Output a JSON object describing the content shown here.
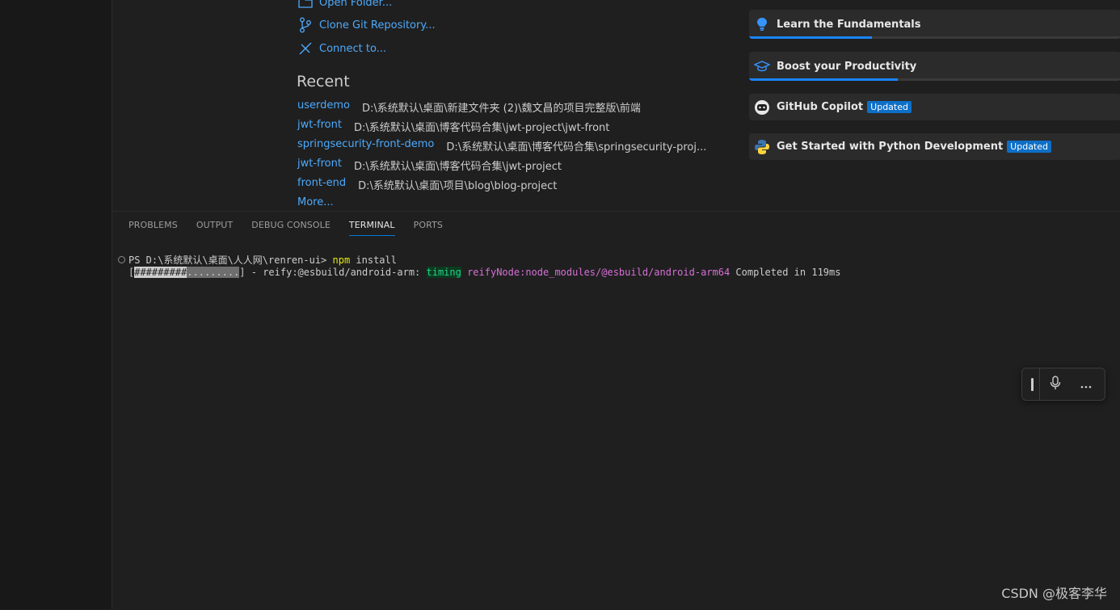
{
  "start": {
    "links": [
      {
        "label": "Open Folder...",
        "icon": "folder-icon"
      },
      {
        "label": "Clone Git Repository...",
        "icon": "git-branch-icon"
      },
      {
        "label": "Connect to...",
        "icon": "remote-icon"
      }
    ]
  },
  "recent": {
    "title": "Recent",
    "items": [
      {
        "name": "userdemo",
        "path": "D:\\系统默认\\桌面\\新建文件夹 (2)\\魏文昌的项目完整版\\前端"
      },
      {
        "name": "jwt-front",
        "path": "D:\\系统默认\\桌面\\博客代码合集\\jwt-project\\jwt-front"
      },
      {
        "name": "springsecurity-front-demo",
        "path": "D:\\系统默认\\桌面\\博客代码合集\\springsecurity-proj..."
      },
      {
        "name": "jwt-front",
        "path": "D:\\系统默认\\桌面\\博客代码合集\\jwt-project"
      },
      {
        "name": "front-end",
        "path": "D:\\系统默认\\桌面\\项目\\blog\\blog-project"
      }
    ],
    "more": "More..."
  },
  "walkthroughs": [
    {
      "title": "Learn the Fundamentals",
      "icon": "lightbulb-icon",
      "badge": "",
      "progress": 0.33
    },
    {
      "title": "Boost your Productivity",
      "icon": "mortarboard-icon",
      "badge": "",
      "progress": 0.4
    },
    {
      "title": "GitHub Copilot",
      "icon": "copilot-icon",
      "badge": "Updated",
      "progress": null
    },
    {
      "title": "Get Started with Python Development",
      "icon": "python-icon",
      "badge": "Updated",
      "progress": null
    }
  ],
  "panel": {
    "tabs": [
      "PROBLEMS",
      "OUTPUT",
      "DEBUG CONSOLE",
      "TERMINAL",
      "PORTS"
    ],
    "active_tab": "TERMINAL"
  },
  "terminal": {
    "prompt": "PS D:\\系统默认\\桌面\\人人网\\renren-ui> ",
    "command": "npm",
    "command_args": " install",
    "progress_open": "[",
    "progress_done": "#########",
    "progress_left": ".........",
    "progress_close": "]",
    "status_prefix": " - reify:@esbuild/android-arm: ",
    "timing": "timing",
    "node": " reifyNode:node_modules/@esbuild/android-arm64",
    "completed": " Completed in 119ms"
  },
  "watermark": "CSDN @极客李华",
  "colors": {
    "link": "#4daafc",
    "accent": "#0078d4",
    "badge": "#0e6fc7",
    "terminal_yellow": "#e5e510",
    "terminal_green": "#23d18b",
    "terminal_magenta": "#d670d6"
  }
}
